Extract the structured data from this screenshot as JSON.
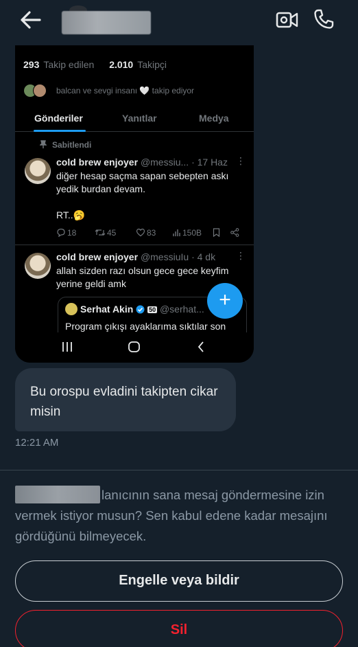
{
  "header": {
    "back_icon": "arrow-left-icon",
    "video_icon": "video-camera-icon",
    "call_icon": "phone-icon"
  },
  "shared_profile": {
    "stats": {
      "following_count": "293",
      "following_label": "Takip edilen",
      "followers_count": "2.010",
      "followers_label": "Takipçi"
    },
    "followed_by": "balcan ve sevgi insanı 🤍 takip ediyor",
    "tabs": [
      {
        "label": "Gönderiler",
        "active": true
      },
      {
        "label": "Yanıtlar",
        "active": false
      },
      {
        "label": "Medya",
        "active": false
      }
    ],
    "pinned_label": "Sabitlendi",
    "tweets": [
      {
        "name": "cold brew enjoyer",
        "handle": "@messiu...",
        "time": "· 17 Haz",
        "text": "diğer hesap saçma sapan sebepten askı yedik burdan devam.",
        "extra": "RT..🥱",
        "replies": "18",
        "retweets": "45",
        "likes": "83",
        "views": "150B"
      },
      {
        "name": "cold brew enjoyer",
        "handle": "@messiuIu",
        "time": "· 4 dk",
        "text": "allah sizden razı olsun gece gece keyfim yerine geldi amk",
        "quote": {
          "name": "Serhat Akin",
          "handle": "@serhat...",
          "text": "Program çıkışı ayaklarıma sıktılar son"
        }
      }
    ],
    "fab_label": "+"
  },
  "message": {
    "text": "Bu orospu evladini takipten cikar misin",
    "timestamp": "12:21 AM"
  },
  "request_notice": {
    "text": "lanıcının sana mesaj göndermesine izin vermek istiyor musun? Sen kabul edene kadar mesajını gördüğünü bilmeyecek."
  },
  "actions": {
    "block_label": "Engelle veya bildir",
    "delete_label": "Sil"
  },
  "colors": {
    "background": "#15202b",
    "accent": "#1d9bf0",
    "danger": "#f4212e",
    "bubble": "#273340"
  }
}
